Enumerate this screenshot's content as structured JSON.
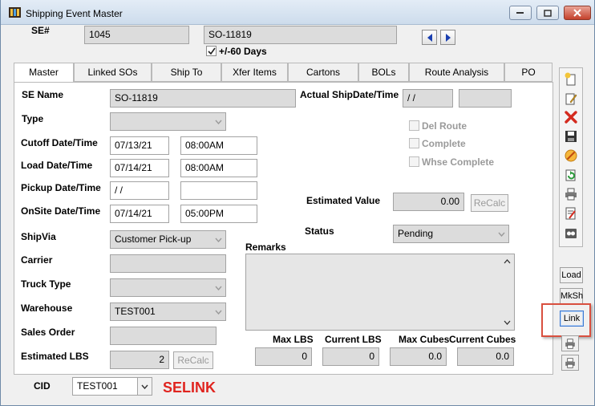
{
  "window": {
    "title": "Shipping Event Master"
  },
  "header": {
    "se_label": "SE#",
    "se_number": "1045",
    "se_name": "SO-11819",
    "range_checkbox_label": "+/-60 Days",
    "range_checked": true
  },
  "tabs": [
    {
      "label": "Master",
      "active": true
    },
    {
      "label": "Linked SOs"
    },
    {
      "label": "Ship To"
    },
    {
      "label": "Xfer Items"
    },
    {
      "label": "Cartons"
    },
    {
      "label": "BOLs"
    },
    {
      "label": "Route Analysis"
    },
    {
      "label": "PO"
    }
  ],
  "master": {
    "se_name_label": "SE Name",
    "se_name_value": "SO-11819",
    "type_label": "Type",
    "type_value": "",
    "cutoff_label": "Cutoff Date/Time",
    "cutoff_date": "07/13/21",
    "cutoff_time": "08:00AM",
    "load_label": "Load Date/Time",
    "load_date": "07/14/21",
    "load_time": "08:00AM",
    "pickup_label": "Pickup Date/Time",
    "pickup_date": " / /",
    "pickup_time": "",
    "onsite_label": "OnSite Date/Time",
    "onsite_date": "07/14/21",
    "onsite_time": "05:00PM",
    "shipvia_label": "ShipVia",
    "shipvia_value": "Customer Pick-up",
    "carrier_label": "Carrier",
    "carrier_value": "",
    "trucktype_label": "Truck Type",
    "trucktype_value": "",
    "warehouse_label": "Warehouse",
    "warehouse_value": "TEST001",
    "salesorder_label": "Sales Order",
    "salesorder_value": "",
    "estlbs_label": "Estimated LBS",
    "estlbs_value": "2",
    "recalc_label": "ReCalc",
    "actual_ship_label": "Actual ShipDate/Time",
    "actual_ship_date": " / /",
    "actual_ship_time": "",
    "del_route_label": "Del Route",
    "complete_label": "Complete",
    "whse_complete_label": "Whse Complete",
    "est_value_label": "Estimated Value",
    "est_value": "0.00",
    "status_label": "Status",
    "status_value": "Pending",
    "remarks_label": "Remarks",
    "remarks_value": "",
    "totals_headers": [
      "Max LBS",
      "Current LBS",
      "Max Cubes",
      "Current Cubes"
    ],
    "totals_values": [
      "0",
      "0",
      "0.0",
      "0.0"
    ]
  },
  "footer": {
    "cid_label": "CID",
    "cid_value": "TEST001",
    "form_code": "SELINK"
  },
  "sidebar": {
    "load_label": "Load",
    "mksh_label": "MkSh",
    "link_label": "Link"
  },
  "colors": {
    "highlight": "#d9503f",
    "form_code": "#e0241f",
    "accent_blue": "#1a3fb0"
  }
}
